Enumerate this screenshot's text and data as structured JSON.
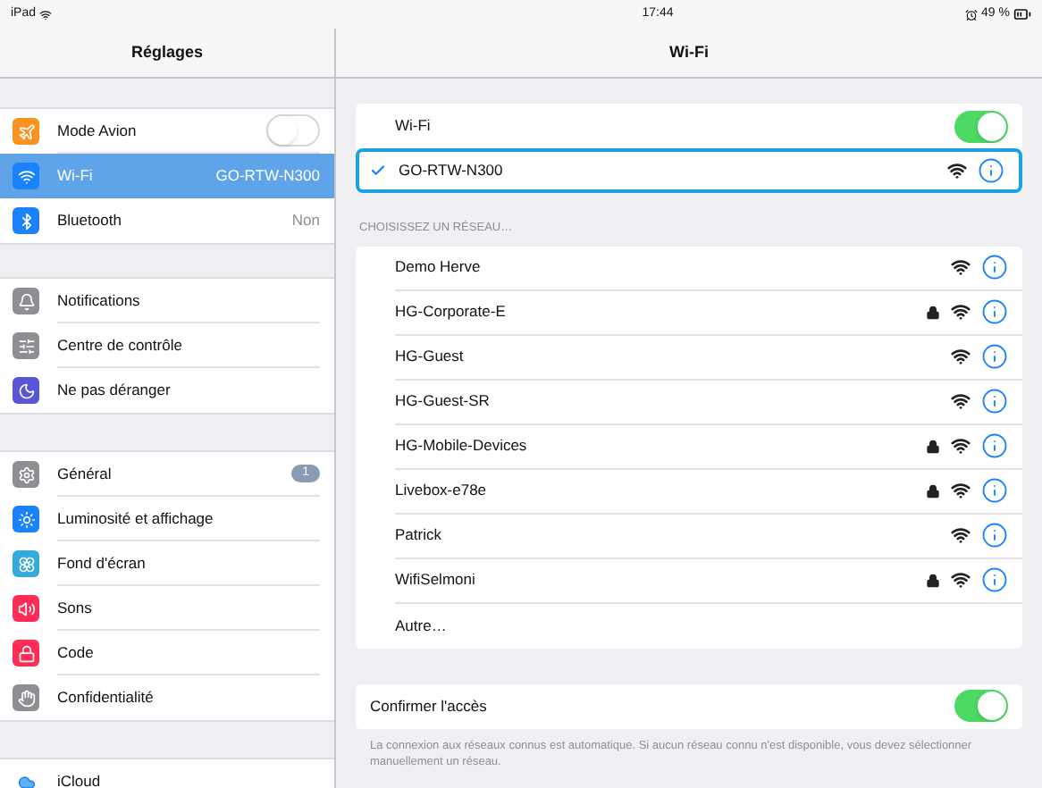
{
  "status_bar": {
    "device": "iPad",
    "time": "17:44",
    "battery": "49 %"
  },
  "sidebar": {
    "title": "Réglages",
    "groups": [
      {
        "items": [
          {
            "label": "Mode Avion",
            "kind": "toggle",
            "on": false,
            "selected": false
          },
          {
            "label": "Wi-Fi",
            "kind": "value",
            "value": "GO-RTW-N300",
            "selected": true
          },
          {
            "label": "Bluetooth",
            "kind": "value",
            "value": "Non",
            "selected": false
          }
        ]
      },
      {
        "items": [
          {
            "label": "Notifications",
            "kind": "plain",
            "selected": false
          },
          {
            "label": "Centre de contrôle",
            "kind": "plain",
            "selected": false
          },
          {
            "label": "Ne pas déranger",
            "kind": "plain",
            "selected": false
          }
        ]
      },
      {
        "items": [
          {
            "label": "Général",
            "kind": "badge",
            "badge": "1",
            "selected": false
          },
          {
            "label": "Luminosité et affichage",
            "kind": "plain",
            "selected": false
          },
          {
            "label": "Fond d'écran",
            "kind": "plain",
            "selected": false
          },
          {
            "label": "Sons",
            "kind": "plain",
            "selected": false
          },
          {
            "label": "Code",
            "kind": "plain",
            "selected": false
          },
          {
            "label": "Confidentialité",
            "kind": "plain",
            "selected": false
          }
        ]
      },
      {
        "items": [
          {
            "label": "iCloud",
            "kind": "plain",
            "selected": false
          }
        ]
      }
    ]
  },
  "detail": {
    "title": "Wi-Fi",
    "wifi": {
      "label": "Wi-Fi",
      "on": true
    },
    "current": {
      "name": "GO-RTW-N300",
      "locked": false
    },
    "section_header": "CHOISISSEZ UN RÉSEAU…",
    "networks": [
      {
        "name": "Demo Herve",
        "locked": false
      },
      {
        "name": "HG-Corporate-E",
        "locked": true
      },
      {
        "name": "HG-Guest",
        "locked": false
      },
      {
        "name": "HG-Guest-SR",
        "locked": false
      },
      {
        "name": "HG-Mobile-Devices",
        "locked": true
      },
      {
        "name": "Livebox-e78e",
        "locked": true
      },
      {
        "name": "Patrick",
        "locked": false
      },
      {
        "name": "WifiSelmoni",
        "locked": true
      }
    ],
    "other": "Autre…",
    "ask": {
      "label": "Confirmer l'accès",
      "on": true
    },
    "footnote": "La connexion aux réseaux connus est automatique. Si aucun réseau connu n'est disponible, vous devez sélectionner manuellement un réseau."
  }
}
